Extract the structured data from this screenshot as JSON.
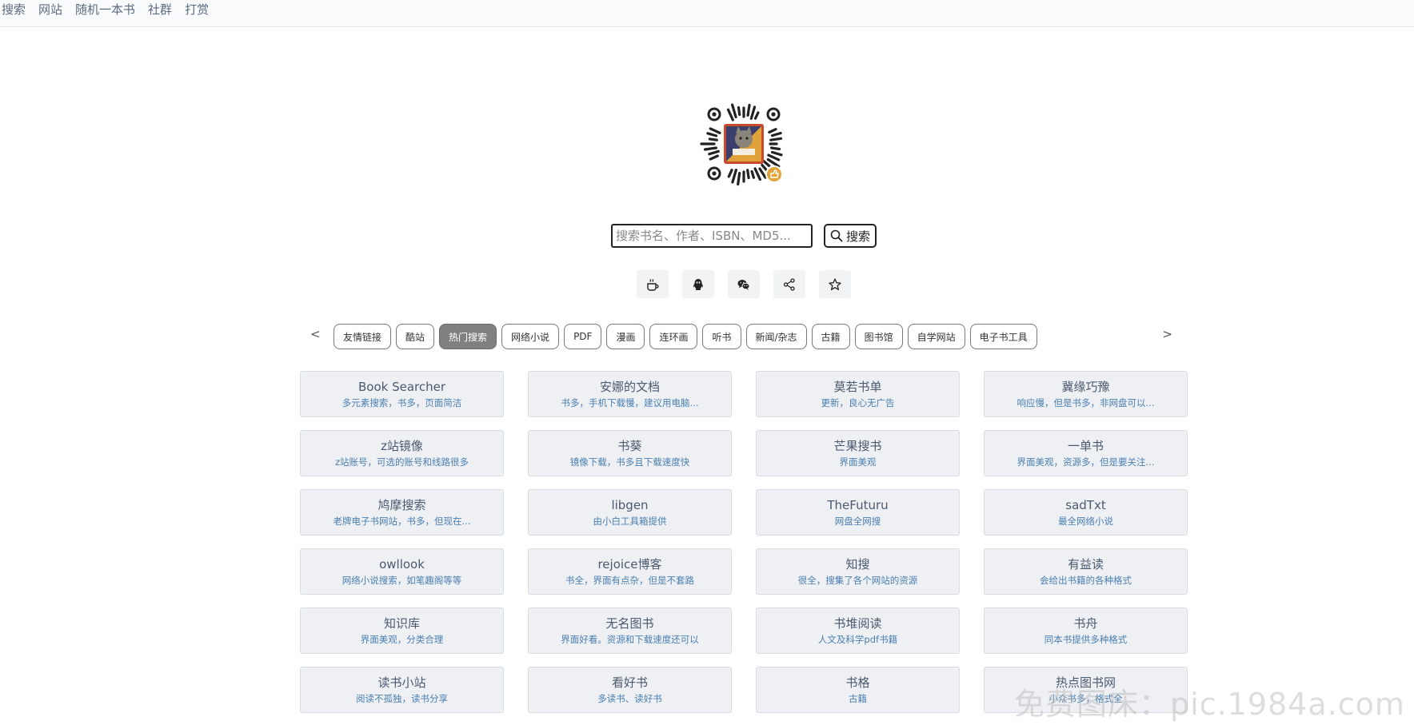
{
  "nav": {
    "items": [
      "搜索",
      "网站",
      "随机一本书",
      "社群",
      "打赏"
    ]
  },
  "search": {
    "placeholder": "搜索书名、作者、ISBN、MD5...",
    "button_label": "搜索"
  },
  "icon_buttons": [
    "coffee-icon",
    "qq-icon",
    "wechat-icon",
    "share-icon",
    "star-icon"
  ],
  "tabs": {
    "prev": "<",
    "next": ">",
    "items": [
      "友情链接",
      "酷站",
      "热门搜索",
      "网络小说",
      "PDF",
      "漫画",
      "连环画",
      "听书",
      "新闻/杂志",
      "古籍",
      "图书馆",
      "自学网站",
      "电子书工具"
    ],
    "active_index": 2
  },
  "cards": [
    {
      "title": "Book Searcher",
      "desc": "多元素搜索，书多，页面简洁"
    },
    {
      "title": "安娜的文档",
      "desc": "书多，手机下载慢，建议用电脑..."
    },
    {
      "title": "莫若书单",
      "desc": "更新，良心无广告"
    },
    {
      "title": "冀缘巧豫",
      "desc": "响应慢，但是书多，非网盘可以..."
    },
    {
      "title": "z站镜像",
      "desc": "z站账号，可选的账号和线路很多"
    },
    {
      "title": "书葵",
      "desc": "镜像下载，书多且下载速度快"
    },
    {
      "title": "芒果搜书",
      "desc": "界面美观"
    },
    {
      "title": "一单书",
      "desc": "界面美观，资源多，但是要关注..."
    },
    {
      "title": "鸠摩搜索",
      "desc": "老牌电子书网站，书多，但现在..."
    },
    {
      "title": "libgen",
      "desc": "由小白工具箱提供"
    },
    {
      "title": "TheFuturu",
      "desc": "网盘全网搜"
    },
    {
      "title": "sadTxt",
      "desc": "最全网络小说"
    },
    {
      "title": "owllook",
      "desc": "网络小说搜索，如笔趣阁等等"
    },
    {
      "title": "rejoice博客",
      "desc": "书全，界面有点杂，但是不套路"
    },
    {
      "title": "知搜",
      "desc": "很全，搜集了各个网站的资源"
    },
    {
      "title": "有益读",
      "desc": "会给出书籍的各种格式"
    },
    {
      "title": "知识库",
      "desc": "界面美观，分类合理"
    },
    {
      "title": "无名图书",
      "desc": "界面好看。资源和下载速度还可以"
    },
    {
      "title": "书堆阅读",
      "desc": "人文及科学pdf书籍"
    },
    {
      "title": "书舟",
      "desc": "同本书提供多种格式"
    },
    {
      "title": "读书小站",
      "desc": "阅读不孤独，读书分享"
    },
    {
      "title": "看好书",
      "desc": "多读书、读好书"
    },
    {
      "title": "书格",
      "desc": "古籍"
    },
    {
      "title": "热点图书网",
      "desc": "小众书多，格式全"
    }
  ],
  "watermark": "免费图床：pic.1984a.com"
}
